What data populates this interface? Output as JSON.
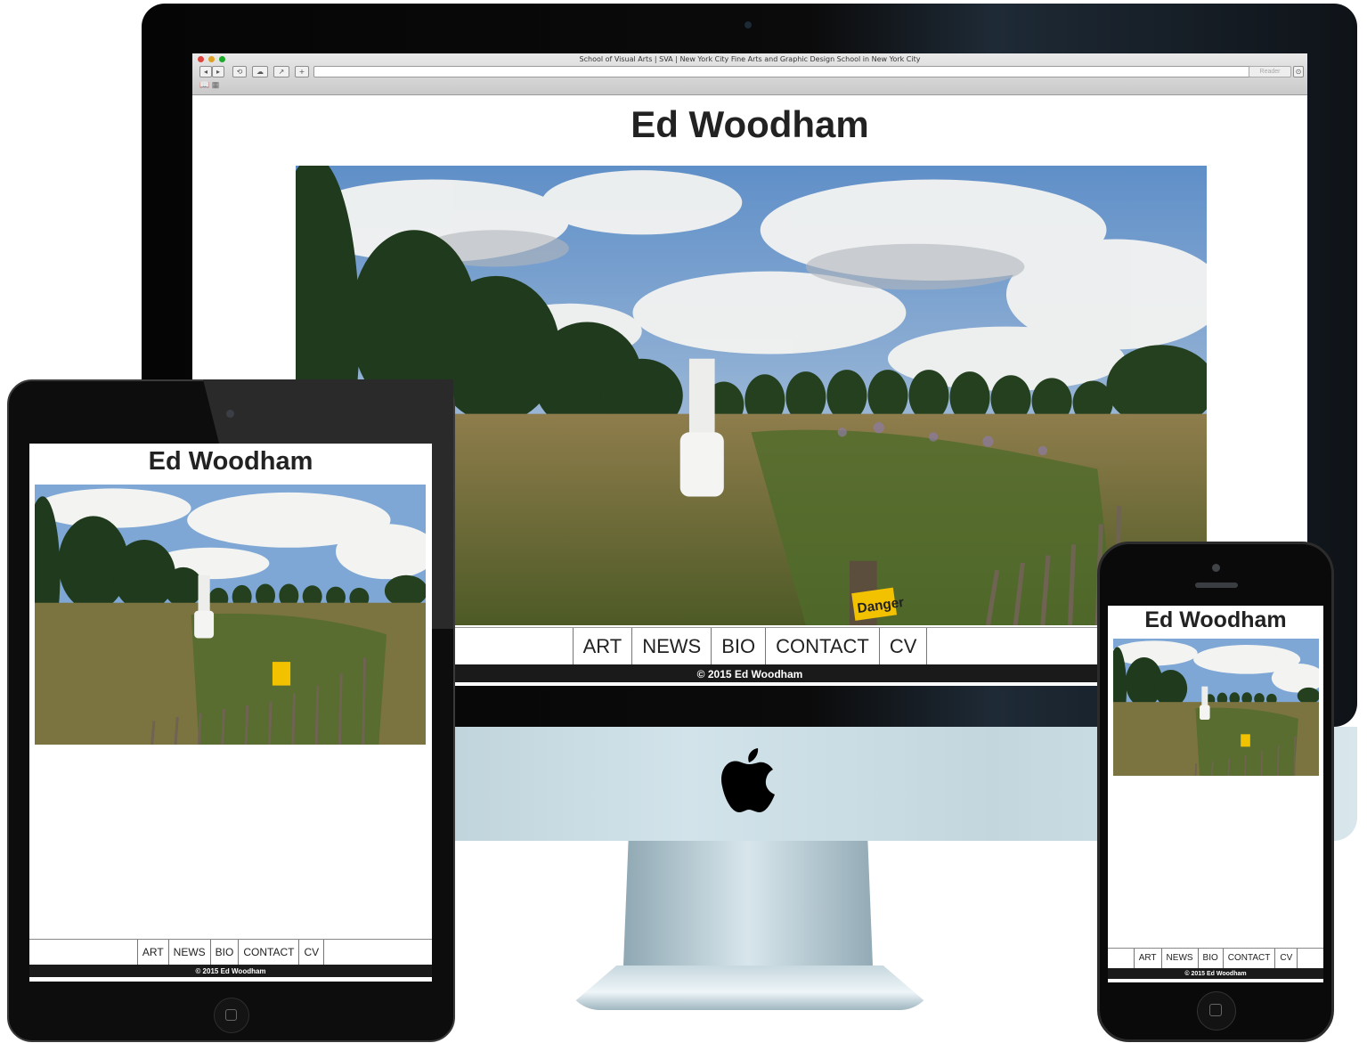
{
  "browser": {
    "window_title": "School of Visual Arts | SVA | New York City Fine Arts and Graphic Design School in New York City",
    "reader_label": "Reader"
  },
  "site": {
    "title": "Ed Woodham",
    "nav": [
      "ART",
      "NEWS",
      "BIO",
      "CONTACT",
      "CV"
    ],
    "footer": "© 2015 Ed Woodham",
    "photo_sign_text": "Danger"
  },
  "colors": {
    "footer_bg": "#1a1a1a",
    "sky": "#7ea7d6",
    "trees": "#1f3a1c",
    "grass": "#6b6a35",
    "sign": "#f2c200"
  },
  "icons": [
    "apple-logo-icon",
    "home-button-icon",
    "camera-icon",
    "back-arrow-icon",
    "forward-arrow-icon",
    "reload-icon",
    "share-icon",
    "add-tab-icon",
    "bookmarks-icon"
  ]
}
